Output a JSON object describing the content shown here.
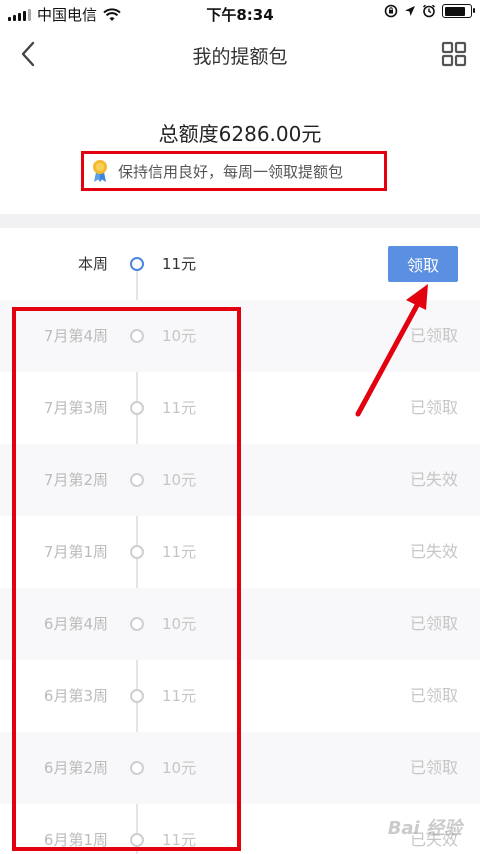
{
  "status_bar": {
    "carrier": "中国电信",
    "time": "下午8:34"
  },
  "nav": {
    "title": "我的提额包"
  },
  "header": {
    "total_label": "总额度6286.00元",
    "tip": "保持信用良好，每周一领取提额包"
  },
  "current_week": {
    "label": "本周",
    "amount": "11元",
    "button": "领取"
  },
  "history": [
    {
      "label": "7月第4周",
      "amount": "10元",
      "state": "已领取"
    },
    {
      "label": "7月第3周",
      "amount": "11元",
      "state": "已领取"
    },
    {
      "label": "7月第2周",
      "amount": "10元",
      "state": "已失效"
    },
    {
      "label": "7月第1周",
      "amount": "11元",
      "state": "已失效"
    },
    {
      "label": "6月第4周",
      "amount": "10元",
      "state": "已领取"
    },
    {
      "label": "6月第3周",
      "amount": "11元",
      "state": "已领取"
    },
    {
      "label": "6月第2周",
      "amount": "10元",
      "state": "已领取"
    },
    {
      "label": "6月第1周",
      "amount": "11元",
      "state": "已失效"
    }
  ],
  "watermark": "Bai 经验",
  "colors": {
    "accent": "#5b8fe2",
    "annotation": "#e3000f"
  }
}
